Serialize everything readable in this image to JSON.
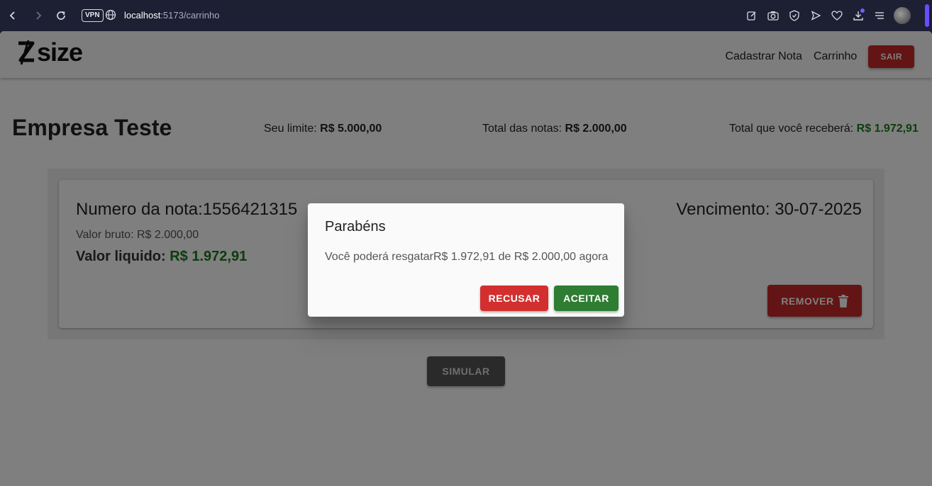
{
  "browser": {
    "vpn_label": "VPN",
    "url_host": "localhost",
    "url_path": ":5173/carrinho",
    "icons": [
      "back-icon",
      "forward-icon",
      "reload-icon",
      "globe-icon",
      "edit-icon",
      "camera-icon",
      "shield-icon",
      "send-icon",
      "heart-icon",
      "download-icon",
      "menu-icon",
      "avatar"
    ]
  },
  "header": {
    "logo_text": "size",
    "nav": [
      "Cadastrar Nota",
      "Carrinho"
    ],
    "logout_label": "SAIR"
  },
  "summary": {
    "company": "Empresa Teste",
    "limit_label": "Seu limite: ",
    "limit_value": "R$ 5.000,00",
    "total_label": "Total das notas: ",
    "total_value": "R$ 2.000,00",
    "receive_label": "Total que você receberá: ",
    "receive_value": "R$ 1.972,91"
  },
  "note": {
    "number_label": "Numero da nota:",
    "number_value": "1556421315",
    "due_label": "Vencimento: ",
    "due_value": "30-07-2025",
    "gross_label": "Valor bruto: ",
    "gross_value": "R$ 2.000,00",
    "net_label": "Valor liquido: ",
    "net_value": "R$ 1.972,91",
    "remove_label": "REMOVER"
  },
  "simulate_label": "SIMULAR",
  "dialog": {
    "title": "Parabéns",
    "message": "Você poderá resgatarR$ 1.972,91 de R$ 2.000,00 agora",
    "decline_label": "RECUSAR",
    "accept_label": "ACEITAR"
  },
  "colors": {
    "danger": "#c62828",
    "success": "#2e7d32",
    "money_green": "#1b7a1b"
  }
}
